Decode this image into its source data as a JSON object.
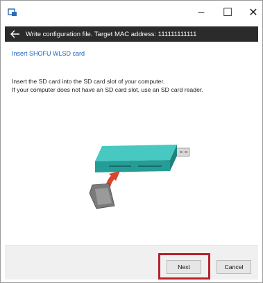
{
  "window": {
    "controls": {
      "minimize": "–",
      "maximize": "☐",
      "close": "✕"
    }
  },
  "header": {
    "title": "Write configuration file. Target MAC address: 111111111111",
    "back_icon": "arrow-left-icon"
  },
  "content": {
    "section_title": "Insert SHOFU WLSD card",
    "instructions": [
      "Insert the SD card into the SD card slot of your computer.",
      "If your computer does not have an SD card slot, use an SD card reader."
    ],
    "illustration": "sd-card-reader-illustration"
  },
  "footer": {
    "next_label": "Next",
    "cancel_label": "Cancel"
  },
  "colors": {
    "header_bg": "#2b2b2b",
    "title_blue": "#1a63c4",
    "highlight_red": "#b5222c",
    "reader_teal": "#2fb8b0",
    "arrow_red": "#d9452e"
  }
}
